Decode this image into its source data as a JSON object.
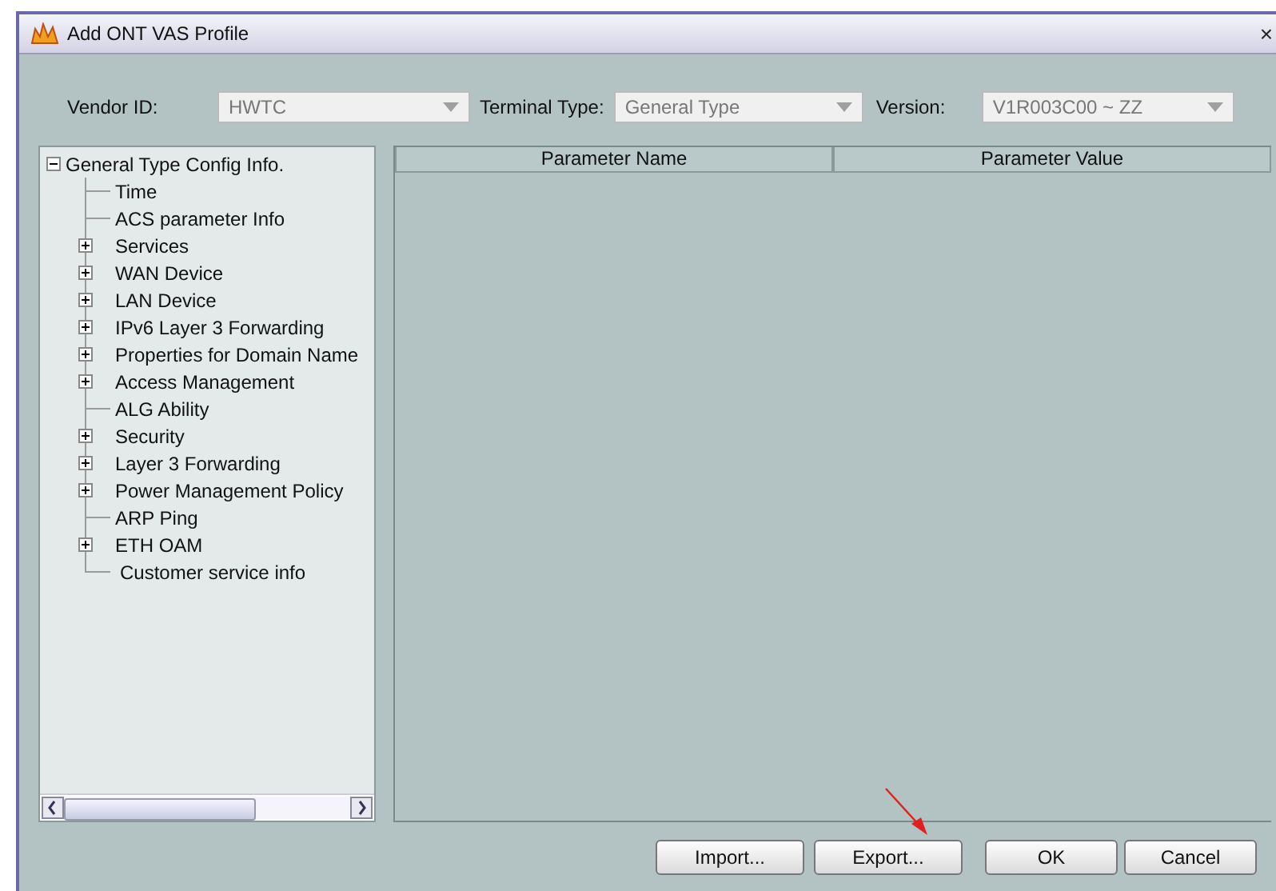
{
  "window": {
    "title": "Add ONT VAS Profile",
    "close": "×"
  },
  "filters": [
    {
      "label": "Vendor ID:",
      "value": "HWTC"
    },
    {
      "label": "Terminal Type:",
      "value": "General Type"
    },
    {
      "label": "Version:",
      "value": "V1R003C00 ~ ZZ"
    }
  ],
  "tree": {
    "label": "General Type Config Info.",
    "expanded": true,
    "children": [
      {
        "label": "Time"
      },
      {
        "label": "ACS  parameter Info"
      },
      {
        "label": "Services",
        "expanded": false
      },
      {
        "label": "WAN Device",
        "expanded": false
      },
      {
        "label": "LAN Device",
        "expanded": false
      },
      {
        "label": "IPv6 Layer 3 Forwarding",
        "expanded": false
      },
      {
        "label": "Properties for Domain Name",
        "expanded": false
      },
      {
        "label": "Access Management",
        "expanded": false
      },
      {
        "label": "ALG Ability"
      },
      {
        "label": "Security",
        "expanded": false
      },
      {
        "label": "Layer 3 Forwarding",
        "expanded": false
      },
      {
        "label": "Power Management Policy",
        "expanded": false
      },
      {
        "label": "ARP Ping"
      },
      {
        "label": "ETH OAM",
        "expanded": false
      },
      {
        "label": "Customer service info"
      }
    ]
  },
  "table": {
    "columns": [
      "Parameter Name",
      "Parameter Value"
    ]
  },
  "buttons": [
    {
      "label": "Import..."
    },
    {
      "label": "Export..."
    },
    {
      "label": "OK"
    },
    {
      "label": "Cancel"
    }
  ]
}
